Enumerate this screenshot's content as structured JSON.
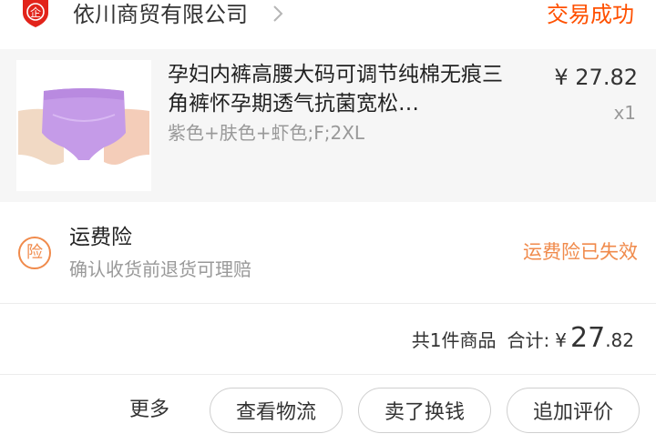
{
  "header": {
    "shop_icon": "shop-shield-icon",
    "shop_icon_glyph": "企",
    "shop_name": "依川商贸有限公司",
    "status": "交易成功",
    "accent_color": "#ff5000"
  },
  "product": {
    "title": "孕妇内裤高腰大码可调节纯棉无痕三角裤怀孕期透气抗菌宽松…",
    "sku": "紫色+肤色+虾色;F;2XL",
    "price": "¥ 27.82",
    "quantity": "x1",
    "image": "product-thumbnail"
  },
  "insurance": {
    "icon_glyph": "险",
    "title": "运费险",
    "description": "确认收货前退货可理赔",
    "status": "运费险已失效",
    "color": "#f08a4b"
  },
  "summary": {
    "count": "共1件商品",
    "label": "合计:",
    "currency": "¥",
    "amount_int": "27",
    "amount_dec": ".82"
  },
  "actions": {
    "more": "更多",
    "logistics": "查看物流",
    "resell": "卖了换钱",
    "review": "追加评价"
  }
}
